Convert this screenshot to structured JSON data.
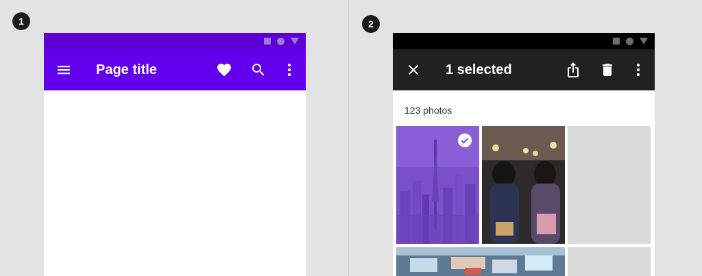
{
  "steps": [
    "1",
    "2"
  ],
  "screen1": {
    "app_bar": {
      "title": "Page title",
      "nav_icon": "menu-icon",
      "actions": [
        "heart-icon",
        "search-icon",
        "more-vert-icon"
      ]
    },
    "colors": {
      "app_bar": "#6200ee",
      "status_bar": "#5d00d4"
    }
  },
  "screen2": {
    "app_bar": {
      "title": "1 selected",
      "nav_icon": "close-icon",
      "actions": [
        "share-icon",
        "delete-icon",
        "more-vert-icon"
      ]
    },
    "photos_count": "123 photos",
    "photos": [
      {
        "name": "city-tower-photo",
        "selected": true
      },
      {
        "name": "festival-kimono-photo",
        "selected": false
      },
      {
        "name": "empty-photo-placeholder",
        "selected": false
      },
      {
        "name": "blurred-street-photo",
        "selected": false
      },
      {
        "name": "empty-photo-placeholder",
        "selected": false
      }
    ],
    "colors": {
      "app_bar": "#212121",
      "status_bar": "#000000",
      "selection_overlay": "#7c4dff"
    }
  }
}
